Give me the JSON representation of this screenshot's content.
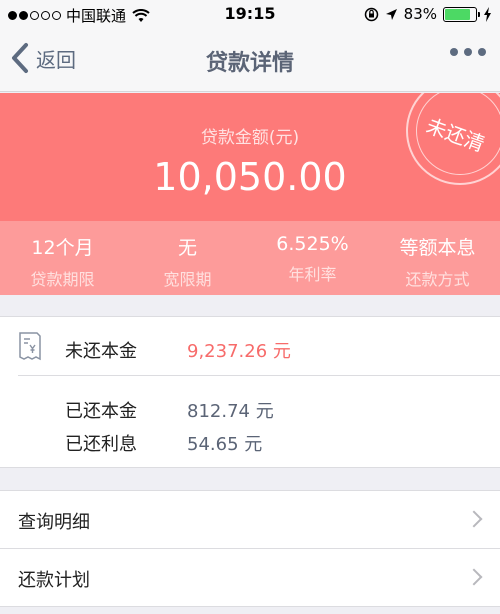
{
  "status_bar": {
    "carrier": "中国联通",
    "time": "19:15",
    "battery": "83%",
    "battery_level": 0.83
  },
  "nav": {
    "back_label": "返回",
    "title": "贷款详情"
  },
  "summary": {
    "amount_label": "贷款金额(元)",
    "amount": "10,050.00",
    "stamp": "未还清"
  },
  "terms": [
    {
      "value": "12个月",
      "label": "贷款期限"
    },
    {
      "value": "无",
      "label": "宽限期"
    },
    {
      "value": "6.525%",
      "label": "年利率"
    },
    {
      "value": "等额本息",
      "label": "还款方式"
    }
  ],
  "principal": {
    "unpaid_label": "未还本金",
    "unpaid_value": "9,237.26 元",
    "paid_label": "已还本金",
    "paid_value": "812.74 元",
    "interest_label": "已还利息",
    "interest_value": "54.65 元"
  },
  "menu": [
    {
      "label": "查询明细"
    },
    {
      "label": "还款计划"
    }
  ],
  "colors": {
    "accent": "#fd7a79",
    "accent_light": "#fd9b9a",
    "unpaid_text": "#f76b6a",
    "battery": "#4cd964"
  }
}
